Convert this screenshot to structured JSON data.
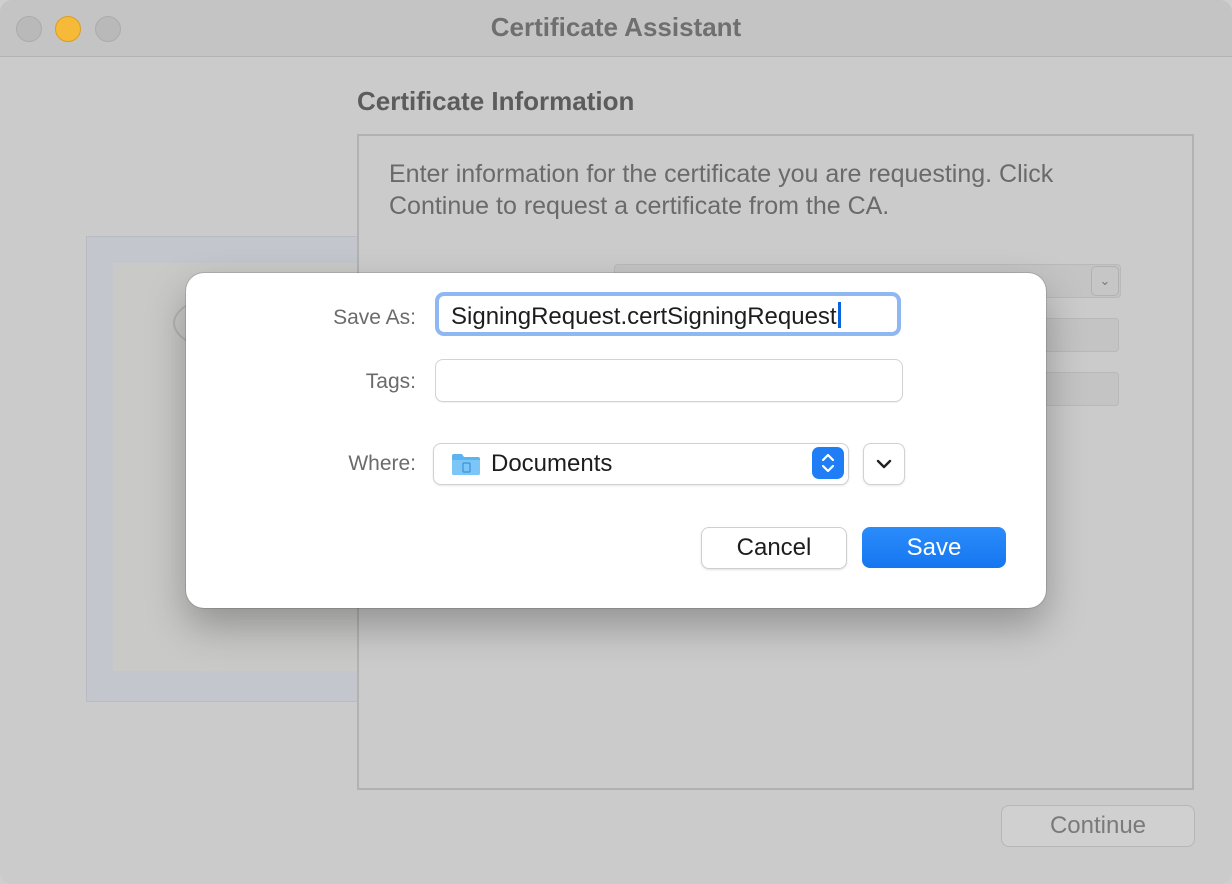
{
  "window": {
    "title": "Certificate Assistant"
  },
  "assistant": {
    "section_title": "Certificate Information",
    "description": "Enter information for the certificate you are requesting. Click Continue to request a certificate from the CA.",
    "continue_label": "Continue"
  },
  "save_sheet": {
    "save_as_label": "Save As:",
    "save_as_value": "SigningRequest.certSigningRequest",
    "tags_label": "Tags:",
    "tags_value": "",
    "where_label": "Where:",
    "where_value": "Documents",
    "cancel_label": "Cancel",
    "save_label": "Save"
  },
  "colors": {
    "accent": "#1f7ef5",
    "minimize": "#f6b938"
  },
  "icons": {
    "folder": "folder-icon",
    "stepper": "up-down-chevron-icon",
    "expand": "chevron-down-icon"
  }
}
